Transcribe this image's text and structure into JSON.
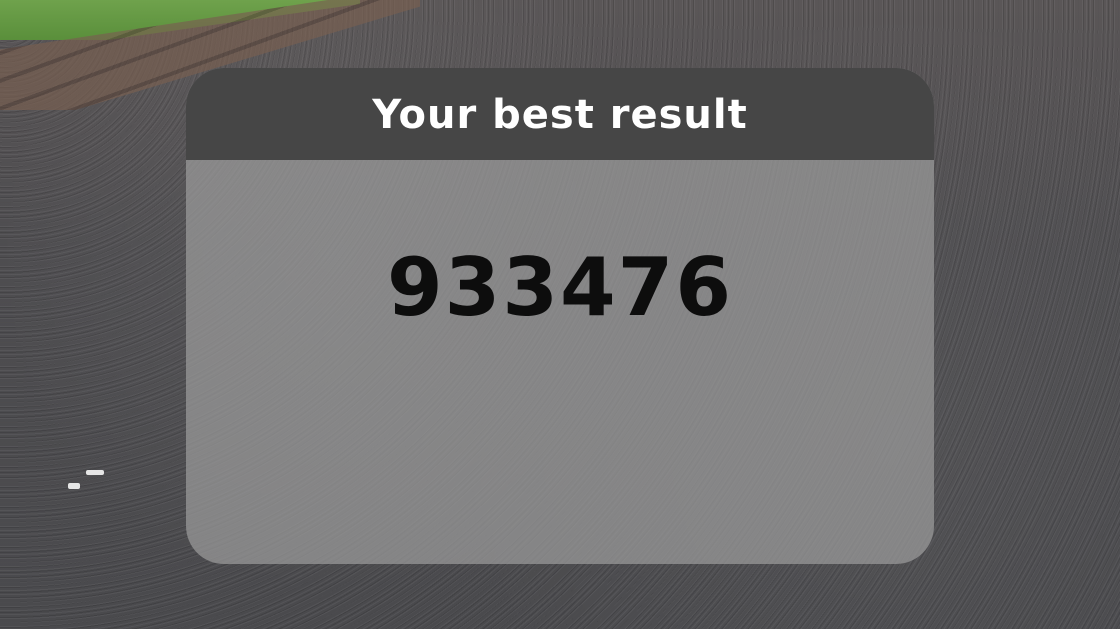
{
  "dialog": {
    "title": "Your best result",
    "best_score": "933476"
  },
  "colors": {
    "header_bg": "#464646",
    "panel_bg": "rgba(155,155,155,0.72)",
    "title_text": "#ffffff",
    "score_text": "#0d0d0d"
  }
}
